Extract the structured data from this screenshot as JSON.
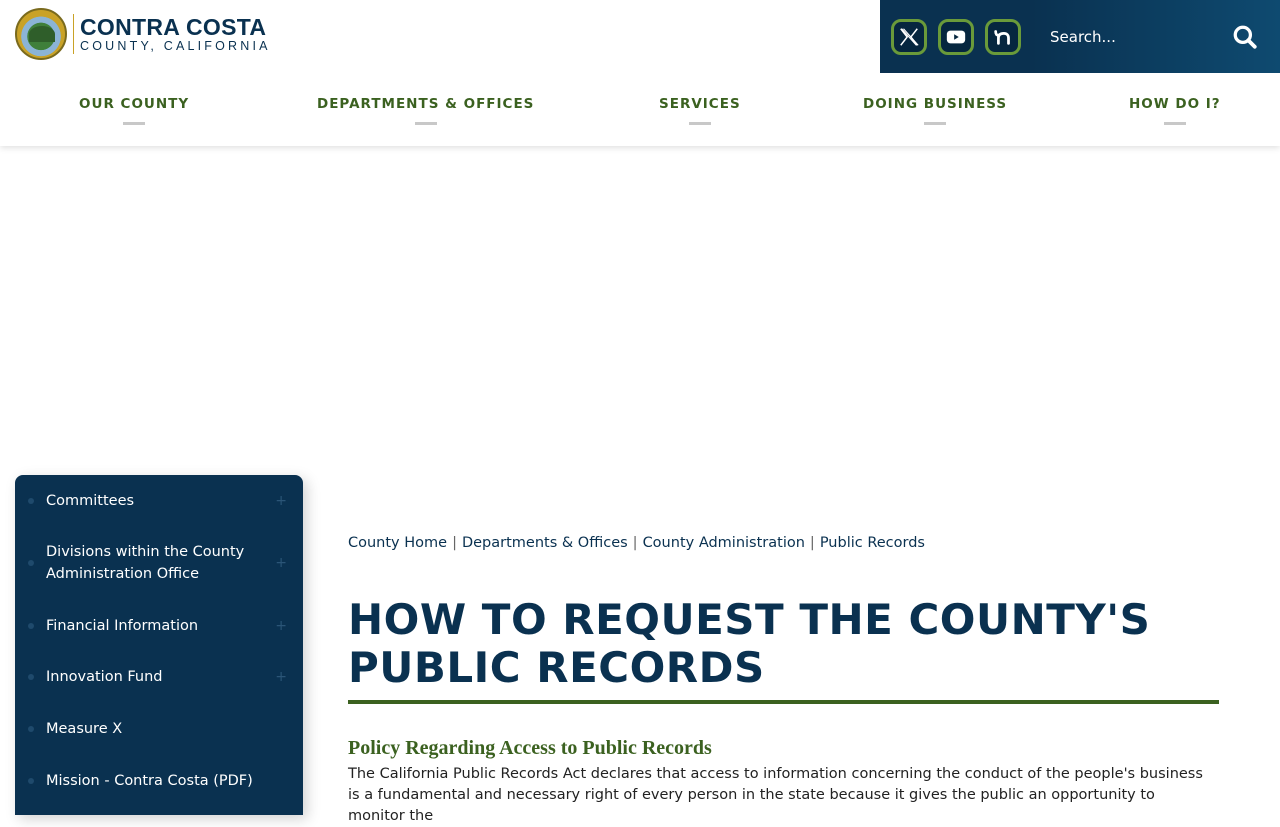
{
  "logo": {
    "title": "CONTRA COSTA",
    "subtitle": "COUNTY, CALIFORNIA"
  },
  "search": {
    "placeholder": "Search..."
  },
  "nav": {
    "items": [
      "OUR COUNTY",
      "DEPARTMENTS & OFFICES",
      "SERVICES",
      "DOING BUSINESS",
      "HOW DO I?"
    ]
  },
  "sidebar": {
    "items": [
      {
        "label": "Committees",
        "expand": "+"
      },
      {
        "label": "Divisions within the County Administration Office",
        "expand": "+"
      },
      {
        "label": "Financial Information",
        "expand": "+"
      },
      {
        "label": "Innovation Fund",
        "expand": "+"
      },
      {
        "label": "Measure X",
        "expand": ""
      },
      {
        "label": "Mission - Contra Costa (PDF)",
        "expand": ""
      }
    ]
  },
  "breadcrumb": {
    "items": [
      "County Home",
      "Departments & Offices",
      "County Administration",
      "Public Records"
    ],
    "separator": "|"
  },
  "main": {
    "title": "HOW TO REQUEST THE COUNTY'S PUBLIC RECORDS",
    "section_heading": "Policy Regarding Access to Public Records",
    "body": "The California Public Records Act declares that access to information concerning the conduct of the people's business is a fundamental and necessary right of every person in the state because it gives the public an opportunity to monitor the"
  },
  "colors": {
    "navy": "#0a3150",
    "green": "#3b6120",
    "accent_green": "#6a9a3a"
  },
  "icons": {
    "social": [
      "x-twitter-icon",
      "youtube-icon",
      "nextdoor-icon"
    ],
    "search": "search-icon"
  }
}
